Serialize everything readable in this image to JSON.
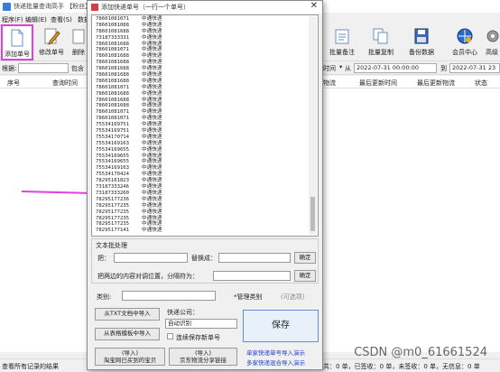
{
  "main": {
    "title": "快递批量查询高手 【粉丝】",
    "menu": [
      "程序(F)",
      "编辑(E)",
      "查看(S)",
      "数据"
    ],
    "toolbar": {
      "add": "添加单号",
      "modify": "修改单号",
      "delete": "删除",
      "batch_note": "批量备注",
      "batch_copy": "批量复制",
      "backup": "备份数据",
      "member": "会员中心",
      "advanced": "高级"
    },
    "filter": {
      "by_label": "根据:",
      "contains_label": "包含",
      "time_label": "时间",
      "from_label": "从",
      "date_from": "2022-07-31 00:00:00",
      "to_label": "到",
      "date_to": "2022-07-31 23"
    },
    "grid_headers": [
      "序号",
      "查询时间",
      "物流",
      "最后更新时间",
      "最后更新物流",
      "状态"
    ],
    "status_left": "查看所有记录的结果",
    "status_right": "共：0 单，已签收：0 单，未签收：0 单，无信息：0 单",
    "watermark": "CSDN @m0_61661524"
  },
  "dialog": {
    "title": "添加快递单号（一行一个单号）",
    "close": "✕",
    "carrier_text": "中通快递",
    "numbers": [
      "78601081071",
      "78601081088",
      "78601081688",
      "73187333331",
      "78601081688",
      "78601081071",
      "78601081688",
      "78601081688",
      "78601081688",
      "78601081688",
      "78601081688",
      "78601081071",
      "78601081688",
      "78601081688",
      "78601081688",
      "78601081071",
      "78601081071",
      "75534169751",
      "75534169751",
      "75534170714",
      "75534169163",
      "75534169655",
      "75534169655",
      "75534169655",
      "75534169163",
      "75534170424",
      "78295161823",
      "73187333246",
      "73187333260",
      "78295177236",
      "78295177235",
      "78295177235",
      "78295177235",
      "78295177235",
      "78295177141"
    ],
    "text_processing": {
      "group_label": "文本批处理",
      "replace_label": "把：",
      "replace_with_label": "替换成：",
      "confirm1": "确定",
      "move_label": "把两边的内容对调位置，分隔符为：",
      "confirm2": "确定"
    },
    "category": {
      "label": "类别:",
      "manage": "*管理类别",
      "optional": "(可选项)"
    },
    "import_txt": "从TXT文档中导入",
    "import_table": "从表格模板中导入",
    "company_label": "快递公司：",
    "company_value": "自动识别",
    "save_checkbox_label": "连续保存新单号",
    "save": "保存",
    "import_taobao": "(导入)\n淘宝网已买到的宝贝",
    "import_jd": "(导入)\n京东物流分享链接",
    "link1": "单家快递单号导入演示",
    "link2": "多家快递混合导入演示"
  }
}
